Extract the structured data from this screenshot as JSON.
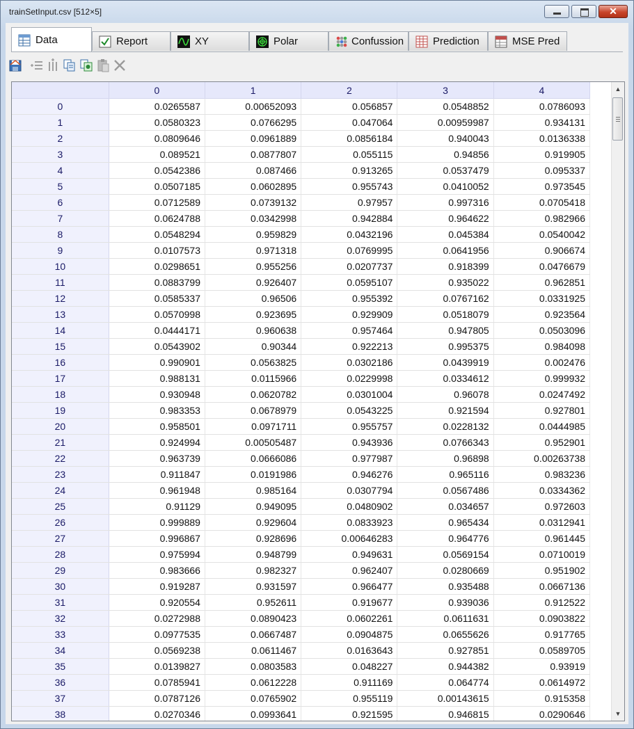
{
  "window": {
    "title": "trainSetInput.csv [512×5]"
  },
  "tabs": [
    {
      "label": "Data",
      "icon": "table-icon",
      "active": true
    },
    {
      "label": "Report",
      "icon": "checkbox-icon",
      "active": false
    },
    {
      "label": "XY",
      "icon": "xy-graph-icon",
      "active": false
    },
    {
      "label": "Polar",
      "icon": "polar-graph-icon",
      "active": false
    },
    {
      "label": "Confussion",
      "icon": "dots-matrix-icon",
      "active": false
    },
    {
      "label": "Prediction",
      "icon": "grid-icon",
      "active": false
    },
    {
      "label": "MSE Pred",
      "icon": "mse-icon",
      "active": false
    }
  ],
  "toolbar": [
    {
      "name": "save-icon",
      "enabled": true
    },
    {
      "name": "insert-rows-icon",
      "enabled": false
    },
    {
      "name": "insert-columns-icon",
      "enabled": false
    },
    {
      "name": "copy-icon",
      "enabled": true
    },
    {
      "name": "copy-special-icon",
      "enabled": true
    },
    {
      "name": "paste-icon",
      "enabled": false
    },
    {
      "name": "delete-icon",
      "enabled": false
    }
  ],
  "grid": {
    "columns": [
      "0",
      "1",
      "2",
      "3",
      "4"
    ],
    "rows": [
      [
        "0",
        "0.0265587",
        "0.00652093",
        "0.056857",
        "0.0548852",
        "0.0786093"
      ],
      [
        "1",
        "0.0580323",
        "0.0766295",
        "0.047064",
        "0.00959987",
        "0.934131"
      ],
      [
        "2",
        "0.0809646",
        "0.0961889",
        "0.0856184",
        "0.940043",
        "0.0136338"
      ],
      [
        "3",
        "0.089521",
        "0.0877807",
        "0.055115",
        "0.94856",
        "0.919905"
      ],
      [
        "4",
        "0.0542386",
        "0.087466",
        "0.913265",
        "0.0537479",
        "0.095337"
      ],
      [
        "5",
        "0.0507185",
        "0.0602895",
        "0.955743",
        "0.0410052",
        "0.973545"
      ],
      [
        "6",
        "0.0712589",
        "0.0739132",
        "0.97957",
        "0.997316",
        "0.0705418"
      ],
      [
        "7",
        "0.0624788",
        "0.0342998",
        "0.942884",
        "0.964622",
        "0.982966"
      ],
      [
        "8",
        "0.0548294",
        "0.959829",
        "0.0432196",
        "0.045384",
        "0.0540042"
      ],
      [
        "9",
        "0.0107573",
        "0.971318",
        "0.0769995",
        "0.0641956",
        "0.906674"
      ],
      [
        "10",
        "0.0298651",
        "0.955256",
        "0.0207737",
        "0.918399",
        "0.0476679"
      ],
      [
        "11",
        "0.0883799",
        "0.926407",
        "0.0595107",
        "0.935022",
        "0.962851"
      ],
      [
        "12",
        "0.0585337",
        "0.96506",
        "0.955392",
        "0.0767162",
        "0.0331925"
      ],
      [
        "13",
        "0.0570998",
        "0.923695",
        "0.929909",
        "0.0518079",
        "0.923564"
      ],
      [
        "14",
        "0.0444171",
        "0.960638",
        "0.957464",
        "0.947805",
        "0.0503096"
      ],
      [
        "15",
        "0.0543902",
        "0.90344",
        "0.922213",
        "0.995375",
        "0.984098"
      ],
      [
        "16",
        "0.990901",
        "0.0563825",
        "0.0302186",
        "0.0439919",
        "0.002476"
      ],
      [
        "17",
        "0.988131",
        "0.0115966",
        "0.0229998",
        "0.0334612",
        "0.999932"
      ],
      [
        "18",
        "0.930948",
        "0.0620782",
        "0.0301004",
        "0.96078",
        "0.0247492"
      ],
      [
        "19",
        "0.983353",
        "0.0678979",
        "0.0543225",
        "0.921594",
        "0.927801"
      ],
      [
        "20",
        "0.958501",
        "0.0971711",
        "0.955757",
        "0.0228132",
        "0.0444985"
      ],
      [
        "21",
        "0.924994",
        "0.00505487",
        "0.943936",
        "0.0766343",
        "0.952901"
      ],
      [
        "22",
        "0.963739",
        "0.0666086",
        "0.977987",
        "0.96898",
        "0.00263738"
      ],
      [
        "23",
        "0.911847",
        "0.0191986",
        "0.946276",
        "0.965116",
        "0.983236"
      ],
      [
        "24",
        "0.961948",
        "0.985164",
        "0.0307794",
        "0.0567486",
        "0.0334362"
      ],
      [
        "25",
        "0.91129",
        "0.949095",
        "0.0480902",
        "0.034657",
        "0.972603"
      ],
      [
        "26",
        "0.999889",
        "0.929604",
        "0.0833923",
        "0.965434",
        "0.0312941"
      ],
      [
        "27",
        "0.996867",
        "0.928696",
        "0.00646283",
        "0.964776",
        "0.961445"
      ],
      [
        "28",
        "0.975994",
        "0.948799",
        "0.949631",
        "0.0569154",
        "0.0710019"
      ],
      [
        "29",
        "0.983666",
        "0.982327",
        "0.962407",
        "0.0280669",
        "0.951902"
      ],
      [
        "30",
        "0.919287",
        "0.931597",
        "0.966477",
        "0.935488",
        "0.0667136"
      ],
      [
        "31",
        "0.920554",
        "0.952611",
        "0.919677",
        "0.939036",
        "0.912522"
      ],
      [
        "32",
        "0.0272988",
        "0.0890423",
        "0.0602261",
        "0.0611631",
        "0.0903822"
      ],
      [
        "33",
        "0.0977535",
        "0.0667487",
        "0.0904875",
        "0.0655626",
        "0.917765"
      ],
      [
        "34",
        "0.0569238",
        "0.0611467",
        "0.0163643",
        "0.927851",
        "0.0589705"
      ],
      [
        "35",
        "0.0139827",
        "0.0803583",
        "0.048227",
        "0.944382",
        "0.93919"
      ],
      [
        "36",
        "0.0785941",
        "0.0612228",
        "0.911169",
        "0.064774",
        "0.0614972"
      ],
      [
        "37",
        "0.0787126",
        "0.0765902",
        "0.955119",
        "0.00143615",
        "0.915358"
      ],
      [
        "38",
        "0.0270346",
        "0.0993641",
        "0.921595",
        "0.946815",
        "0.0290646"
      ]
    ]
  },
  "colors": {
    "header_bg": "#e6e8fb",
    "header_text": "#1a1a66",
    "close_button": "#c8462c"
  }
}
